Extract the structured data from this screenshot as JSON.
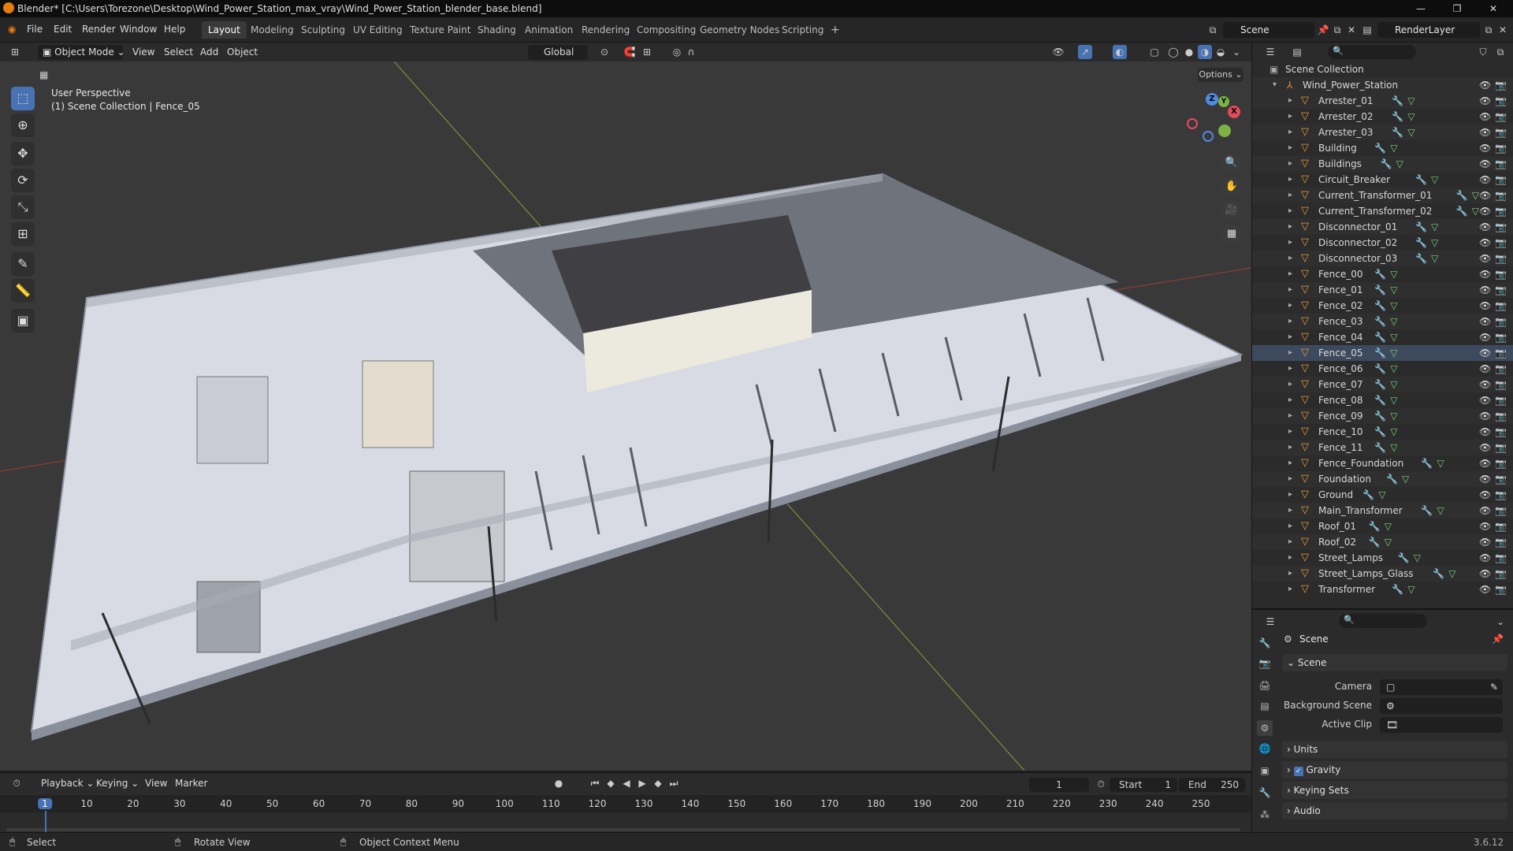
{
  "window": {
    "title": "Blender* [C:\\Users\\Torezone\\Desktop\\Wind_Power_Station_max_vray\\Wind_Power_Station_blender_base.blend]"
  },
  "menu": [
    "File",
    "Edit",
    "Render",
    "Window",
    "Help"
  ],
  "workspaces": [
    "Layout",
    "Modeling",
    "Sculpting",
    "UV Editing",
    "Texture Paint",
    "Shading",
    "Animation",
    "Rendering",
    "Compositing",
    "Geometry Nodes",
    "Scripting"
  ],
  "active_workspace": "Layout",
  "scene_field": "Scene",
  "render_layer_field": "RenderLayer",
  "viewport_header": {
    "mode": "Object Mode",
    "menus": [
      "View",
      "Select",
      "Add",
      "Object"
    ],
    "transform_orientation": "Global",
    "options_label": "Options"
  },
  "viewport": {
    "perspective_label": "User Perspective",
    "context_label": "(1) Scene Collection | Fence_05",
    "gizmo_axes": [
      "X",
      "Y",
      "Z"
    ]
  },
  "outliner": {
    "root": "Scene Collection",
    "collection": "Wind_Power_Station",
    "objects": [
      "Arrester_01",
      "Arrester_02",
      "Arrester_03",
      "Building",
      "Buildings",
      "Circuit_Breaker",
      "Current_Transformer_01",
      "Current_Transformer_02",
      "Disconnector_01",
      "Disconnector_02",
      "Disconnector_03",
      "Fence_00",
      "Fence_01",
      "Fence_02",
      "Fence_03",
      "Fence_04",
      "Fence_05",
      "Fence_06",
      "Fence_07",
      "Fence_08",
      "Fence_09",
      "Fence_10",
      "Fence_11",
      "Fence_Foundation",
      "Foundation",
      "Ground",
      "Main_Transformer",
      "Roof_01",
      "Roof_02",
      "Street_Lamps",
      "Street_Lamps_Glass",
      "Transformer"
    ],
    "selected": "Fence_05"
  },
  "properties": {
    "context": "Scene",
    "panel": "Scene",
    "fields": [
      {
        "label": "Camera",
        "value": ""
      },
      {
        "label": "Background Scene",
        "value": ""
      },
      {
        "label": "Active Clip",
        "value": ""
      }
    ],
    "collapsed_panels": [
      "Units",
      "Gravity",
      "Keying Sets",
      "Audio"
    ],
    "gravity_checked": true
  },
  "timeline": {
    "menus": [
      "Playback",
      "Keying",
      "View",
      "Marker"
    ],
    "current_frame": "1",
    "start_label": "Start",
    "start": "1",
    "end_label": "End",
    "end": "250",
    "ticks": [
      "1",
      "10",
      "20",
      "30",
      "40",
      "50",
      "60",
      "70",
      "80",
      "90",
      "100",
      "110",
      "120",
      "130",
      "140",
      "150",
      "160",
      "170",
      "180",
      "190",
      "200",
      "210",
      "220",
      "230",
      "240",
      "250"
    ]
  },
  "statusbar": {
    "select": "Select",
    "rotate": "Rotate View",
    "context_menu": "Object Context Menu",
    "version": "3.6.12"
  },
  "colors": {
    "accent": "#4772b3",
    "object_icon": "#e6983c",
    "mesh_icon": "#7ad078",
    "modifier_icon": "#7ca0d4"
  }
}
